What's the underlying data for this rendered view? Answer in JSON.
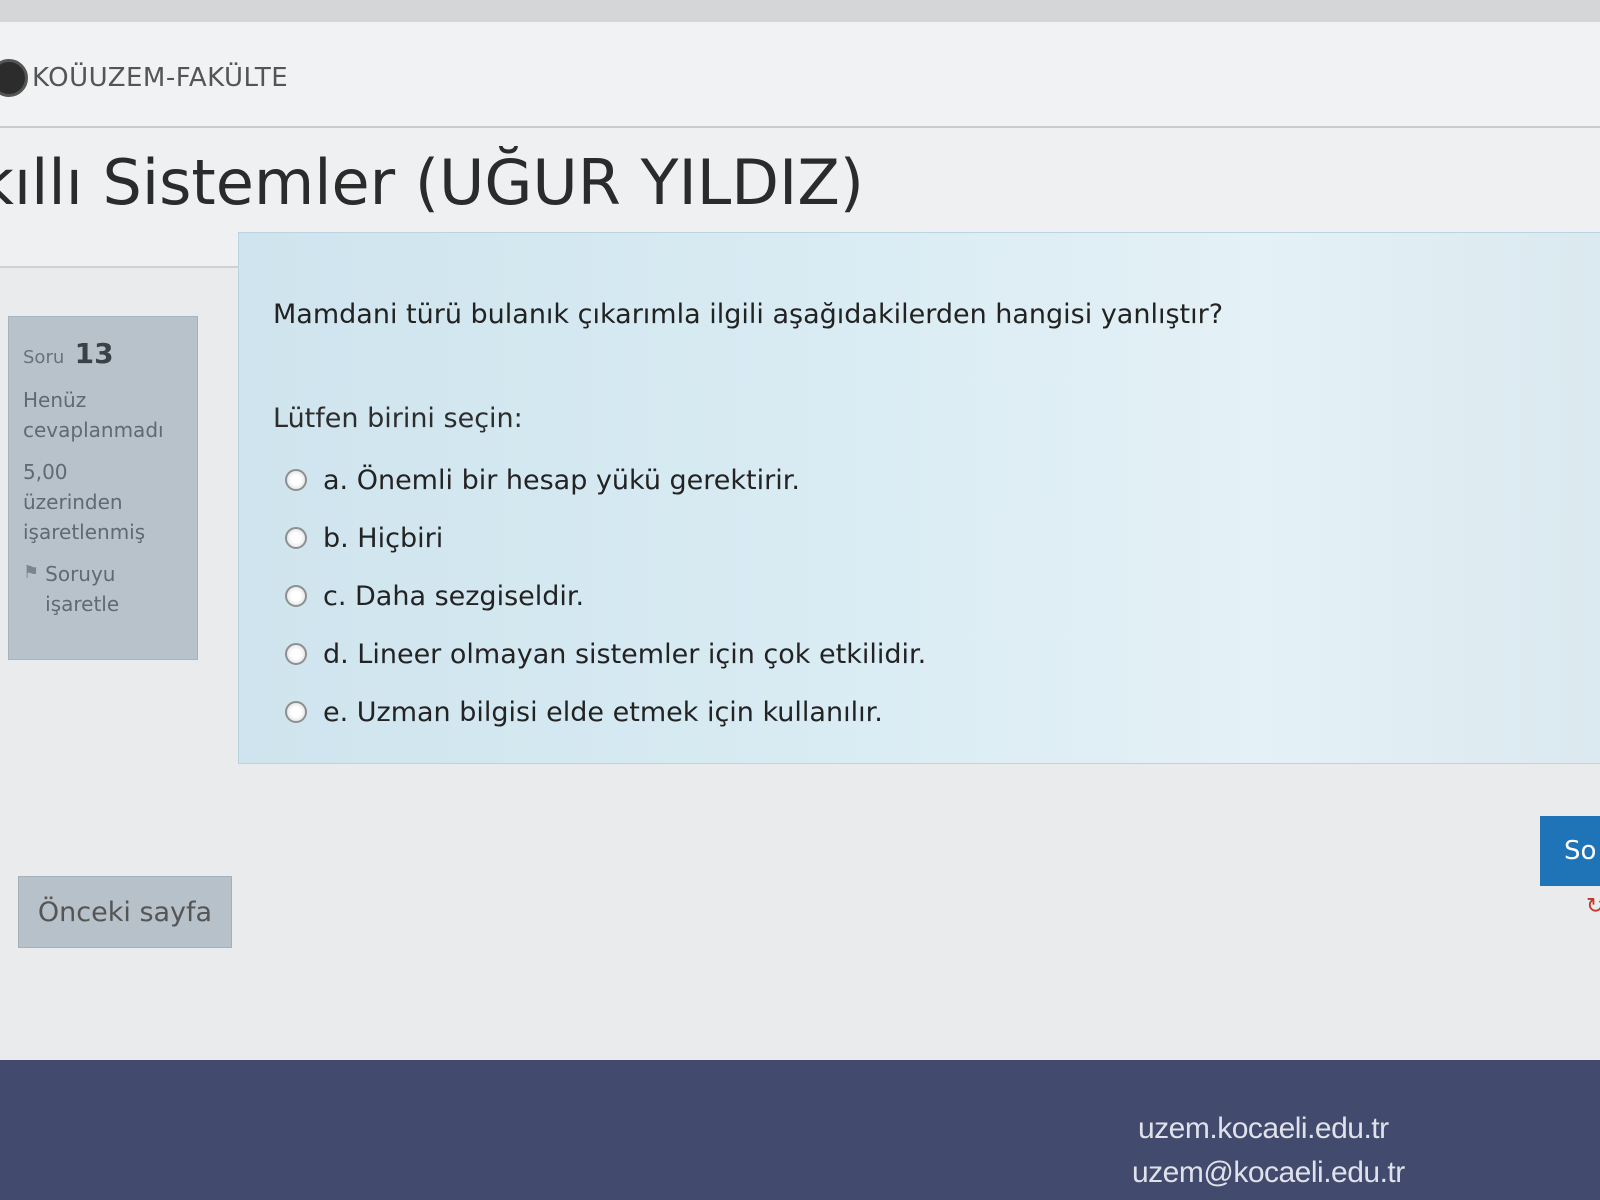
{
  "navbar": {
    "brand": "KOÜUZEM-FAKÜLTE"
  },
  "page": {
    "title": "kıllı Sistemler (UĞUR YILDIZ)"
  },
  "question_info": {
    "label": "Soru",
    "number": "13",
    "status_line1": "Henüz",
    "status_line2": "cevaplanmadı",
    "mark_line1": "5,00",
    "mark_line2": "üzerinden",
    "mark_line3": "işaretlenmiş",
    "flag_line1": "Soruyu",
    "flag_line2": "işaretle"
  },
  "question": {
    "text": "Mamdani türü bulanık çıkarımla ilgili aşağıdakilerden hangisi yanlıştır?",
    "prompt": "Lütfen birini seçin:",
    "options": [
      "a. Önemli bir hesap yükü gerektirir.",
      "b. Hiçbiri",
      "c. Daha sezgiseldir.",
      "d. Lineer olmayan sistemler için çok etkilidir.",
      "e. Uzman bilgisi elde etmek için kullanılır."
    ]
  },
  "navigation": {
    "prev_label": "Önceki sayfa",
    "next_label": "So"
  },
  "footer": {
    "link1": "uzem.kocaeli.edu.tr",
    "link2": "uzem@kocaeli.edu.tr"
  }
}
